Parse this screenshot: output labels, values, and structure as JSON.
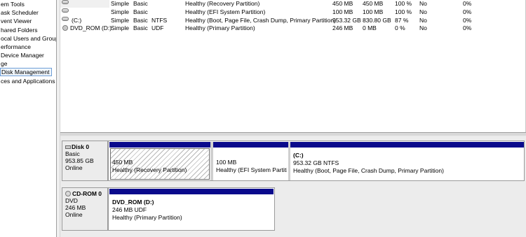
{
  "nav": {
    "items": [
      {
        "label": "em Tools",
        "selected": false
      },
      {
        "label": "ask Scheduler",
        "selected": false
      },
      {
        "label": "vent Viewer",
        "selected": false
      },
      {
        "label": "hared Folders",
        "selected": false
      },
      {
        "label": "ocal Users and Groups",
        "selected": false
      },
      {
        "label": "erformance",
        "selected": false
      },
      {
        "label": "Device Manager",
        "selected": false
      },
      {
        "label": "ge",
        "selected": false
      },
      {
        "label": "Disk Management",
        "selected": true
      },
      {
        "label": "ces and Applications",
        "selected": false
      }
    ]
  },
  "volumes": [
    {
      "icon": "drive-icon",
      "name": "",
      "layout": "Simple",
      "type": "Basic",
      "fs": "",
      "status": "Healthy (Recovery Partition)",
      "capacity": "450 MB",
      "free": "450 MB",
      "pct_free": "100 %",
      "fault_tolerance": "No",
      "overhead": "0%"
    },
    {
      "icon": "drive-icon",
      "name": "",
      "layout": "Simple",
      "type": "Basic",
      "fs": "",
      "status": "Healthy (EFI System Partition)",
      "capacity": "100 MB",
      "free": "100 MB",
      "pct_free": "100 %",
      "fault_tolerance": "No",
      "overhead": "0%"
    },
    {
      "icon": "drive-icon",
      "name": "(C:)",
      "layout": "Simple",
      "type": "Basic",
      "fs": "NTFS",
      "status": "Healthy (Boot, Page File, Crash Dump, Primary Partition)",
      "capacity": "953.32 GB",
      "free": "830.80 GB",
      "pct_free": "87 %",
      "fault_tolerance": "No",
      "overhead": "0%"
    },
    {
      "icon": "dvd-icon",
      "name": "DVD_ROM (D:)",
      "layout": "Simple",
      "type": "Basic",
      "fs": "UDF",
      "status": "Healthy (Primary Partition)",
      "capacity": "246 MB",
      "free": "0 MB",
      "pct_free": "0 %",
      "fault_tolerance": "No",
      "overhead": "0%"
    }
  ],
  "disks": [
    {
      "name": "Disk 0",
      "type": "Basic",
      "size": "953.85 GB",
      "state": "Online",
      "partitions": [
        {
          "name": "",
          "size": "450 MB",
          "status": "Healthy (Recovery Partition)"
        },
        {
          "name": "",
          "size": "100 MB",
          "status": "Healthy (EFI System Partition)"
        },
        {
          "name": "(C:)",
          "size": "953.32 GB NTFS",
          "status": "Healthy (Boot, Page File, Crash Dump, Primary Partition)"
        }
      ]
    },
    {
      "name": "CD-ROM 0",
      "type": "DVD",
      "size": "246 MB",
      "state": "Online",
      "partitions": [
        {
          "name": "DVD_ROM  (D:)",
          "size": "246 MB UDF",
          "status": "Healthy (Primary Partition)"
        }
      ]
    }
  ],
  "colors": {
    "partition_bar": "#0a0a8c",
    "selection_border": "#6f9ed6"
  }
}
